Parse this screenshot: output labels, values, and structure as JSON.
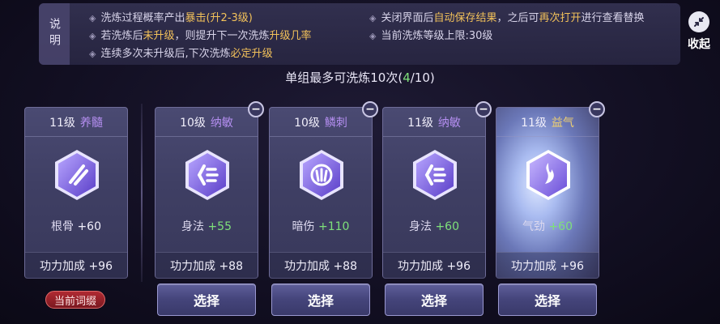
{
  "info": {
    "label": "说明",
    "left_lines": [
      {
        "pre": "洗炼过程概率产出",
        "hl": "暴击(升2-3级)",
        "post": ""
      },
      {
        "pre": "若洗炼后",
        "hl": "未升级",
        "post": "，则提升下一次洗炼",
        "hl2": "升级几率"
      },
      {
        "pre": "连续多次未升级后,下次洗炼",
        "hl": "必定升级",
        "post": ""
      }
    ],
    "right_lines": [
      {
        "pre": "关闭界面后",
        "hl": "自动保存结果",
        "post": "，之后可",
        "hl2": "再次打开",
        "post2": "进行查看替换"
      },
      {
        "pre": "当前洗炼等级上限:30级",
        "hl": "",
        "post": ""
      }
    ]
  },
  "collapse": {
    "label": "收起",
    "icon": "collapse-arrows-icon"
  },
  "wash_count": {
    "pre": "单组最多可洗炼10次(",
    "current": "4",
    "post": "/10)"
  },
  "current_badge": "当前词缀",
  "select_label": "选择",
  "cards": [
    {
      "level": "11级",
      "attr": "养髓",
      "attr_color": "purple",
      "stat_name": "根骨",
      "stat_val": "+60",
      "stat_val_color": "white",
      "bonus": "功力加成 +96",
      "icon": "slash-sigil-icon",
      "removable": false,
      "glow": false
    },
    {
      "level": "10级",
      "attr": "纳敏",
      "attr_color": "purple",
      "stat_name": "身法",
      "stat_val": "+55",
      "stat_val_color": "green",
      "bonus": "功力加成 +88",
      "icon": "dash-sigil-icon",
      "removable": true,
      "glow": false
    },
    {
      "level": "10级",
      "attr": "鳞刺",
      "attr_color": "purple",
      "stat_name": "暗伤",
      "stat_val": "+110",
      "stat_val_color": "green",
      "bonus": "功力加成 +88",
      "icon": "claw-sigil-icon",
      "removable": true,
      "glow": false
    },
    {
      "level": "11级",
      "attr": "纳敏",
      "attr_color": "purple",
      "stat_name": "身法",
      "stat_val": "+60",
      "stat_val_color": "green",
      "bonus": "功力加成 +96",
      "icon": "dash-sigil-icon",
      "removable": true,
      "glow": false
    },
    {
      "level": "11级",
      "attr": "益气",
      "attr_color": "gold",
      "stat_name": "气劲",
      "stat_val": "+60",
      "stat_val_color": "green",
      "bonus": "功力加成 +96",
      "icon": "flame-sigil-icon",
      "removable": true,
      "glow": true
    }
  ],
  "colors": {
    "highlight": "#f2c15a",
    "positive": "#7ee07a",
    "attr_purple": "#b48ef0",
    "attr_gold": "#f0d070"
  }
}
